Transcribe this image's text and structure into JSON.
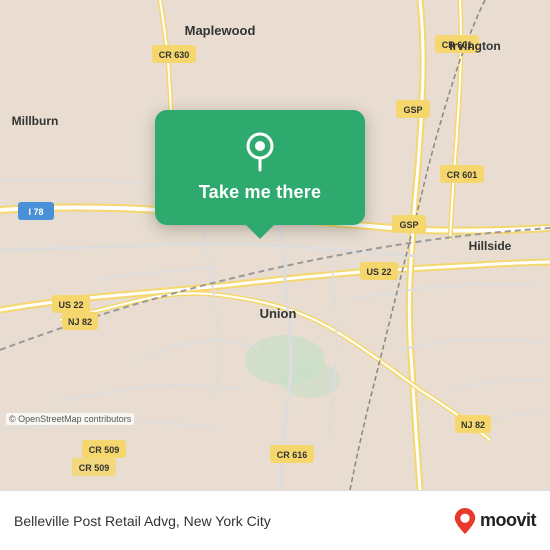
{
  "map": {
    "background_color": "#e8ddd0",
    "attribution": "© OpenStreetMap contributors"
  },
  "popup": {
    "button_label": "Take me there",
    "pin_icon": "location-pin"
  },
  "bottom_bar": {
    "location_text": "Belleville Post Retail Advg, New York City",
    "moovit_label": "moovit"
  },
  "road_labels": [
    "Maplewood",
    "Millburn",
    "Irvington",
    "Hillside",
    "Union",
    "CR 630",
    "CR 601",
    "CR 601",
    "I 78",
    "NJ 82",
    "NJ 82",
    "GSP",
    "GSP",
    "US 22",
    "US 22",
    "CR 509",
    "CR 616"
  ],
  "colors": {
    "map_bg": "#e8ddd0",
    "road_yellow": "#f5d76e",
    "road_white": "#ffffff",
    "green_water": "#c8dfc8",
    "popup_green": "#2eaa6e",
    "moovit_red": "#e8392a"
  }
}
